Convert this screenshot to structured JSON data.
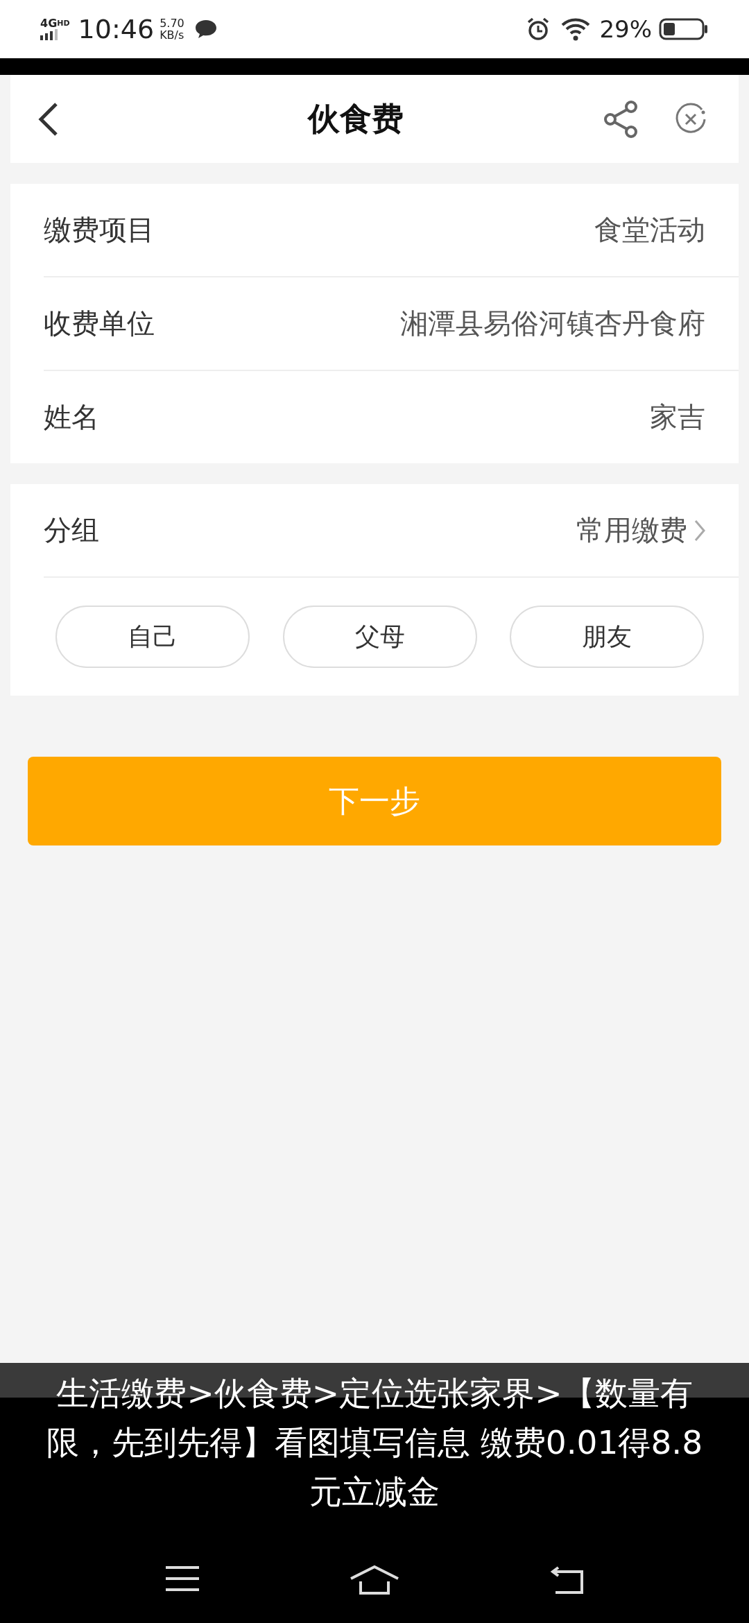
{
  "status_bar": {
    "network": "4G",
    "network_badge": "HD",
    "time": "10:46",
    "speed_value": "5.70",
    "speed_unit": "KB/s",
    "battery": "29%"
  },
  "header": {
    "title": "伙食费"
  },
  "info": [
    {
      "label": "缴费项目",
      "value": "食堂活动"
    },
    {
      "label": "收费单位",
      "value": "湘潭县易俗河镇杏丹食府"
    },
    {
      "label": "姓名",
      "value": "家吉"
    }
  ],
  "group": {
    "label": "分组",
    "value": "常用缴费"
  },
  "group_chips": [
    {
      "label": "自己"
    },
    {
      "label": "父母"
    },
    {
      "label": "朋友"
    }
  ],
  "next_button": "下一步",
  "caption": "生活缴费>伙食费>定位选张家界>【数量有限，先到先得】看图填写信息 缴费0.01得8.8元立减金"
}
